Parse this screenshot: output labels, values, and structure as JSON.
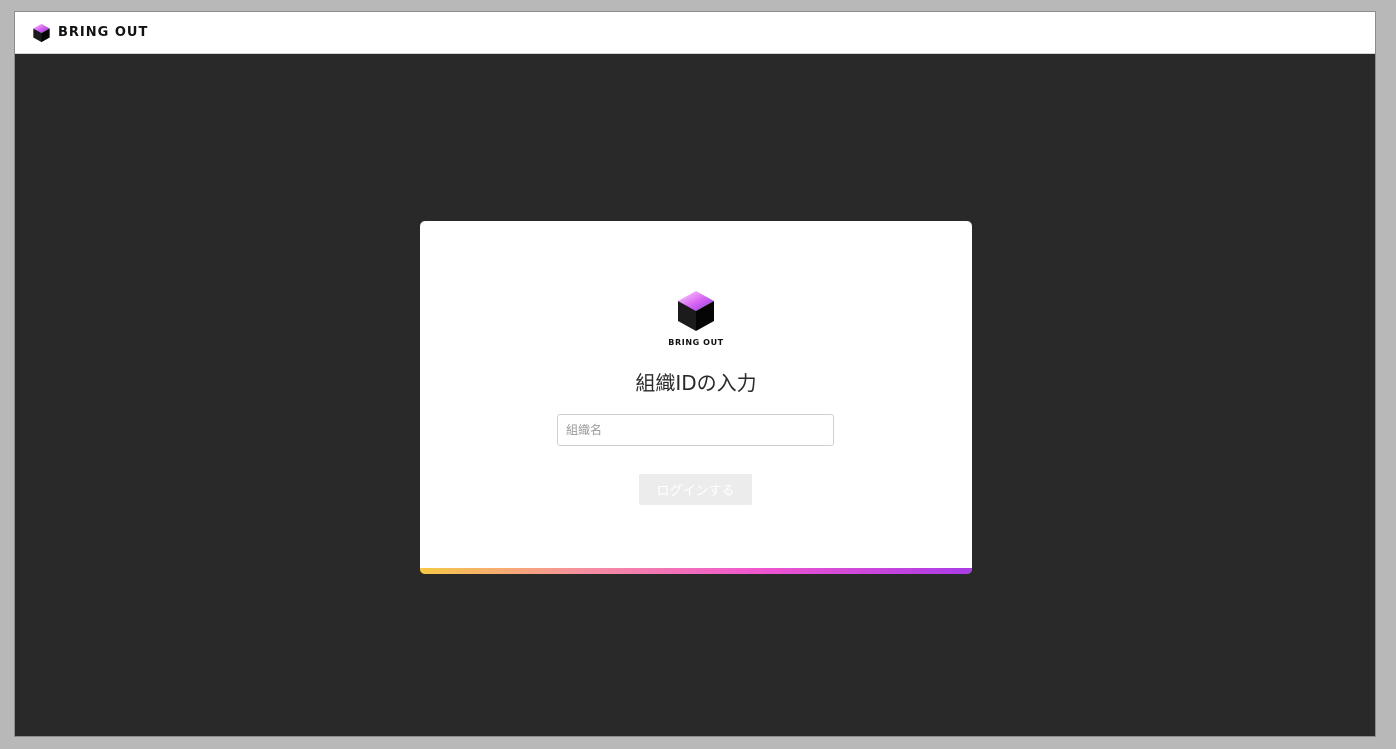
{
  "header": {
    "brand": "BRING OUT",
    "logo_icon": "cube-logo-icon"
  },
  "card": {
    "logo_icon": "cube-logo-icon",
    "brand": "BRING OUT",
    "title": "組織IDの入力",
    "org_input": {
      "value": "",
      "placeholder": "組織名"
    },
    "login_button_label": "ログインする",
    "accent_colors": [
      "#f7c845",
      "#f58ea0",
      "#ef55d0",
      "#a93be6"
    ]
  },
  "colors": {
    "background": "#292929",
    "card": "#ffffff",
    "button_disabled": "#ececec"
  }
}
